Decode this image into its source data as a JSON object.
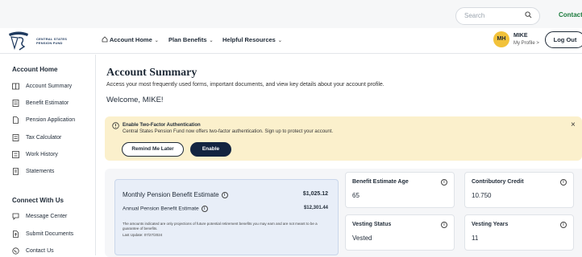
{
  "topbar": {
    "search_placeholder": "Search",
    "contact_label": "Contact U"
  },
  "logo": {
    "line1": "CENTRAL STATES",
    "line2": "PENSION FUND"
  },
  "nav": [
    {
      "label": "Account Home",
      "icon": "home-icon"
    },
    {
      "label": "Plan Benefits"
    },
    {
      "label": "Helpful Resources"
    }
  ],
  "user": {
    "initials": "MH",
    "name": "MIKE",
    "profile_label": "My Profile >"
  },
  "logout_label": "Log Out",
  "sidebar": {
    "section1_title": "Account Home",
    "section1_items": [
      {
        "label": "Account Summary",
        "icon": "book-icon"
      },
      {
        "label": "Benefit Estimator",
        "icon": "calculator-icon"
      },
      {
        "label": "Pension Application",
        "icon": "document-icon"
      },
      {
        "label": "Tax Calculator",
        "icon": "calculator-icon"
      },
      {
        "label": "Work History",
        "icon": "list-icon"
      },
      {
        "label": "Statements",
        "icon": "statement-icon"
      }
    ],
    "section2_title": "Connect With Us",
    "section2_items": [
      {
        "label": "Message Center",
        "icon": "message-icon"
      },
      {
        "label": "Submit Documents",
        "icon": "upload-icon"
      },
      {
        "label": "Contact Us",
        "icon": "phone-icon"
      }
    ]
  },
  "main": {
    "title": "Account Summary",
    "subtitle": "Access your most frequently used forms, important documents, and view key details about your account profile.",
    "welcome": "Welcome, MIKE!"
  },
  "alert": {
    "title": "Enable Two-Factor Authentication",
    "body": "Central States Pension Fund now offers two-factor authentication. Sign up to protect your account.",
    "remind_label": "Remind Me Later",
    "enable_label": "Enable",
    "close": "×"
  },
  "pension": {
    "monthly_label": "Monthly Pension Benefit Estimate",
    "monthly_value": "$1,025.12",
    "annual_label": "Annual Pension Benefit Estimate",
    "annual_value": "$12,301.44",
    "note": "The amounts indicated are only projections of future potential retirement benefits you may earn and are not meant to be a guarantee of benefits.",
    "last_update": "Last Update: 07/27/2024"
  },
  "cards": [
    {
      "label": "Benefit Estimate Age",
      "value": "65"
    },
    {
      "label": "Contributory Credit",
      "value": "10.750"
    },
    {
      "label": "Vesting Status",
      "value": "Vested"
    },
    {
      "label": "Vesting Years",
      "value": "11"
    }
  ],
  "colors": {
    "accent_navy": "#132440",
    "alert_bg": "#fbf0cc",
    "contact_green": "#1a7a3c",
    "avatar_yellow": "#f2c23a"
  }
}
